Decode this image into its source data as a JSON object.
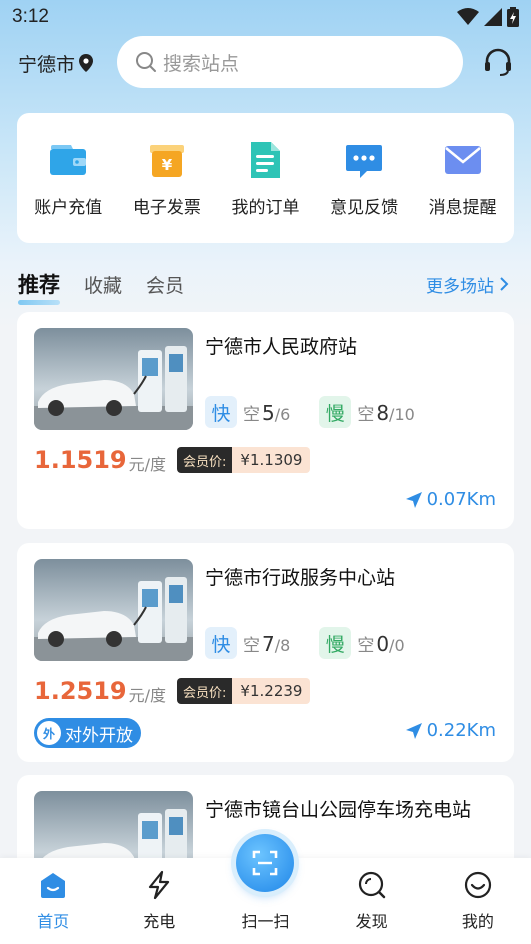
{
  "status_bar": {
    "time": "3:12"
  },
  "header": {
    "city": "宁德市",
    "search_placeholder": "搜索站点"
  },
  "quick_menu": [
    {
      "label": "账户充值",
      "icon": "wallet-icon",
      "color": "#2fa5e8"
    },
    {
      "label": "电子发票",
      "icon": "invoice-icon",
      "color": "#f5a623"
    },
    {
      "label": "我的订单",
      "icon": "order-icon",
      "color": "#2ec4b6"
    },
    {
      "label": "意见反馈",
      "icon": "feedback-icon",
      "color": "#2f8de4"
    },
    {
      "label": "消息提醒",
      "icon": "message-icon",
      "color": "#6c8ef0"
    }
  ],
  "tabs": [
    {
      "label": "推荐",
      "active": true
    },
    {
      "label": "收藏",
      "active": false
    },
    {
      "label": "会员",
      "active": false
    }
  ],
  "more_label": "更多场站",
  "stations": [
    {
      "name": "宁德市人民政府站",
      "fast_label": "快",
      "fast_prefix": "空",
      "fast_avail": "5",
      "fast_total": "/6",
      "slow_label": "慢",
      "slow_prefix": "空",
      "slow_avail": "8",
      "slow_total": "/10",
      "price": "1.1519",
      "price_unit": "元/度",
      "member_label": "会员价:",
      "member_price": "¥1.1309",
      "distance": "0.07Km"
    },
    {
      "name": "宁德市行政服务中心站",
      "fast_label": "快",
      "fast_prefix": "空",
      "fast_avail": "7",
      "fast_total": "/8",
      "slow_label": "慢",
      "slow_prefix": "空",
      "slow_avail": "0",
      "slow_total": "/0",
      "price": "1.2519",
      "price_unit": "元/度",
      "member_label": "会员价:",
      "member_price": "¥1.2239",
      "open_badge_icon": "外",
      "open_badge": "对外开放",
      "distance": "0.22Km"
    },
    {
      "name": "宁德市镜台山公园停车场充电站"
    }
  ],
  "bottom_nav": [
    {
      "label": "首页",
      "icon": "home-icon",
      "active": true
    },
    {
      "label": "充电",
      "icon": "bolt-icon",
      "active": false
    },
    {
      "label": "扫一扫",
      "icon": "scan-icon",
      "active": false
    },
    {
      "label": "发现",
      "icon": "discover-icon",
      "active": false
    },
    {
      "label": "我的",
      "icon": "profile-icon",
      "active": false
    }
  ],
  "colors": {
    "accent": "#2f8de4",
    "price": "#e8663a"
  }
}
